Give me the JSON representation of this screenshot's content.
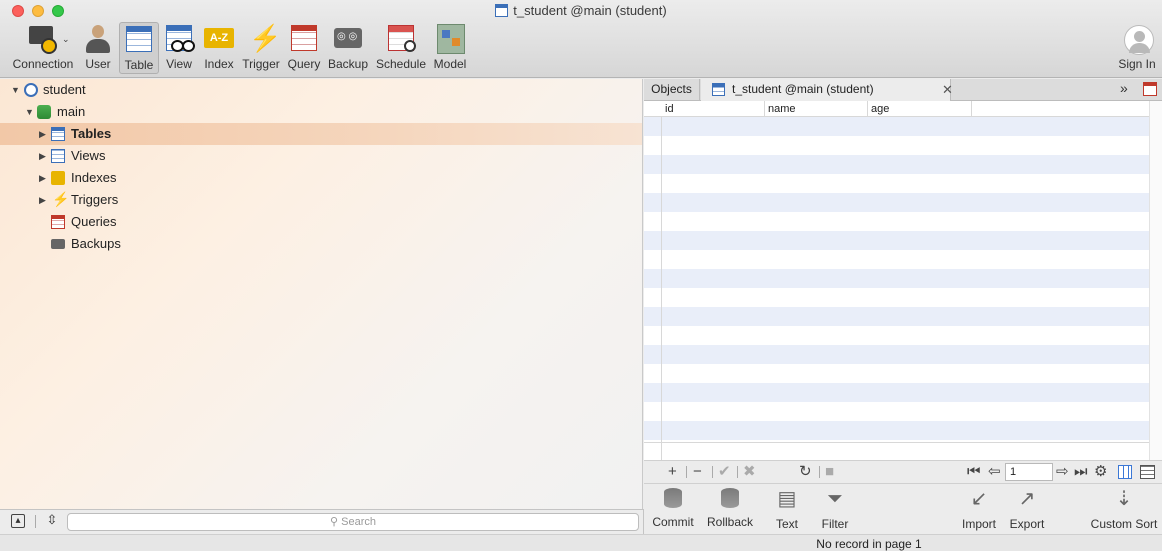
{
  "window": {
    "title": "t_student @main (student)"
  },
  "toolbar": {
    "items": [
      {
        "label": "Connection",
        "icon": "connection-icon"
      },
      {
        "label": "User",
        "icon": "user-icon"
      },
      {
        "label": "Table",
        "icon": "table-icon",
        "active": true
      },
      {
        "label": "View",
        "icon": "view-icon"
      },
      {
        "label": "Index",
        "icon": "index-icon"
      },
      {
        "label": "Trigger",
        "icon": "trigger-icon"
      },
      {
        "label": "Query",
        "icon": "query-icon"
      },
      {
        "label": "Backup",
        "icon": "backup-icon"
      },
      {
        "label": "Schedule",
        "icon": "schedule-icon"
      },
      {
        "label": "Model",
        "icon": "model-icon"
      }
    ],
    "signin": "Sign In"
  },
  "tree": {
    "connection": "student",
    "schema": "main",
    "nodes": [
      {
        "label": "Tables",
        "icon": "table-icon",
        "selected": true
      },
      {
        "label": "Views",
        "icon": "view-icon"
      },
      {
        "label": "Indexes",
        "icon": "index-icon"
      },
      {
        "label": "Triggers",
        "icon": "trigger-icon"
      },
      {
        "label": "Queries",
        "icon": "query-icon"
      },
      {
        "label": "Backups",
        "icon": "backup-icon"
      }
    ]
  },
  "search": {
    "placeholder": "Search"
  },
  "tabs": {
    "objects": "Objects",
    "table_tab": "t_student @main (student)",
    "close": "✕",
    "more": "»"
  },
  "grid": {
    "columns": [
      "id",
      "name",
      "age"
    ],
    "rows": []
  },
  "pager": {
    "page": "1"
  },
  "actions": {
    "commit": "Commit",
    "rollback": "Rollback",
    "text": "Text",
    "filter": "Filter",
    "import": "Import",
    "export": "Export",
    "custom_sort": "Custom Sort"
  },
  "status": {
    "text": "No record in page 1"
  },
  "colors": {
    "selection": "#f2c8a7",
    "table_blue": "#3b6fb8",
    "row_stripe": "#e9eef9"
  }
}
